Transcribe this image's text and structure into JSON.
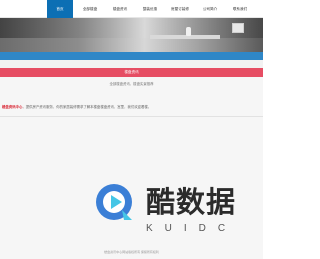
{
  "nav": {
    "items": [
      {
        "label": "首页"
      },
      {
        "label": "全部楼盘"
      },
      {
        "label": "楼盘资讯"
      },
      {
        "label": "整装优惠"
      },
      {
        "label": "房屋订装修"
      },
      {
        "label": "公司简介"
      },
      {
        "label": "联系我们"
      }
    ],
    "active_index": 0
  },
  "section_bar": {
    "title": "楼盘资讯"
  },
  "breadcrumb": {
    "text": "全部楼盘资讯，楼盘实景推荐"
  },
  "notice": {
    "brand": "楼盘资讯中心",
    "text": "，提供房产资讯服务，你的家居装修需求了解本楼盘楼盘资讯，宫里，我们欢迎看楼。"
  },
  "watermark": {
    "brand": "酷数据",
    "sub": "KUIDC"
  },
  "footer": {
    "text": "楼盘资讯中心网站版权所有 保留所有权利"
  },
  "colors": {
    "nav_active": "#0c6fb4",
    "blue_bar": "#2f87c7",
    "red_bar": "#e64d63",
    "brand_red": "#d8202e",
    "logo_blue": "#3b7fd6",
    "logo_cyan": "#45c6e6"
  }
}
